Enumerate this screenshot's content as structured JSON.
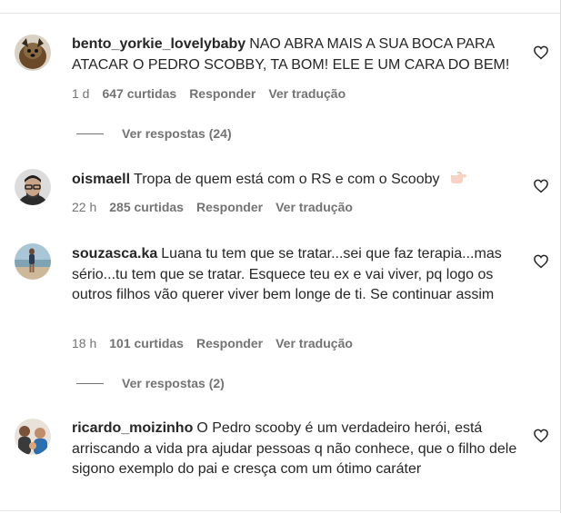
{
  "comments": [
    {
      "username": "bento_yorkie_lovelybaby",
      "text": "NAO ABRA MAIS A SUA BOCA PARA ATACAR O PEDRO SCOBBY, TA BOM! ELE E UM CARA DO BEM!",
      "time": "1 d",
      "likes": "647 curtidas",
      "reply_label": "Responder",
      "translate_label": "Ver tradução",
      "view_replies": "Ver respostas (24)",
      "avatar_icon": "yorkie-dog-avatar"
    },
    {
      "username": "oismaell",
      "text": "Tropa de quem está com o RS e com o Scooby",
      "time": "22 h",
      "likes": "285 curtidas",
      "reply_label": "Responder",
      "translate_label": "Ver tradução",
      "avatar_icon": "man-with-glasses-avatar",
      "emoji_icon": "pointing-hand-emoji"
    },
    {
      "username": "souzasca.ka",
      "text": "Luana tu tem que se tratar...sei que faz terapia...mas sério...tu tem que se tratar. Esquece teu ex e vai viver, pq logo os outros filhos vão querer viver bem longe de ti. Se continuar assim",
      "time": "18 h",
      "likes": "101 curtidas",
      "reply_label": "Responder",
      "translate_label": "Ver tradução",
      "view_replies": "Ver respostas (2)",
      "avatar_icon": "beach-person-avatar"
    },
    {
      "username": "ricardo_moizinho",
      "text": "O Pedro scooby é um verdadeiro herói, está arriscando a vida pra ajudar pessoas q não conhece, que o filho dele sigono exemplo do pai e cresça com um ótimo caráter",
      "avatar_icon": "group-photo-avatar"
    }
  ],
  "colors": {
    "text": "#262626",
    "secondary": "#737373",
    "divider": "#e6e6e6"
  },
  "icons": {
    "like": "heart-outline-icon"
  }
}
